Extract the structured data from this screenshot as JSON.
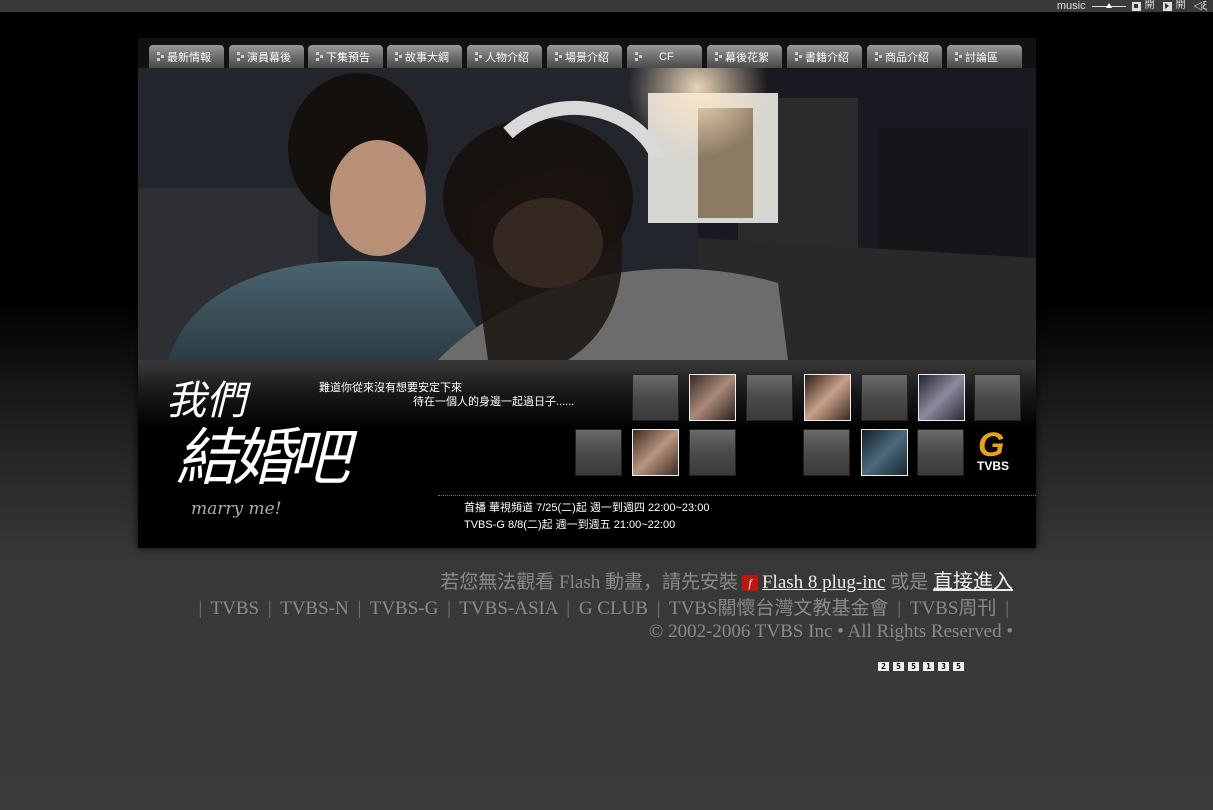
{
  "music": {
    "label": "music",
    "open1": "開",
    "open2": "開"
  },
  "nav": {
    "tabs": [
      "最新情報",
      "演員幕後",
      "下集預告",
      "故事大綱",
      "人物介紹",
      "場景介紹",
      "CF",
      "幕後花絮",
      "書籍介紹",
      "商品介紹",
      "討論區"
    ]
  },
  "logo": {
    "line1": "我們",
    "line2": "結婚吧",
    "script": "marry me!"
  },
  "tagline": {
    "line1": "難道你從來沒有想要安定下來",
    "line2": "待在一個人的身邊一起過日子......"
  },
  "airtimes": {
    "line1": "首播 華視頻道 7/25(二)起 週一到週四 22:00~23:00",
    "line2": "TVBS-G 8/8(二)起 週一到週五 21:00~22:00"
  },
  "brand": {
    "g": "G",
    "name": "TVBS"
  },
  "footer": {
    "flash_prefix": "若您無法觀看 Flash 動畫，請先安裝",
    "flash_link": "Flash 8 plug-inc",
    "or_text": "或是",
    "enter_link": "直接進入",
    "links": [
      "TVBS",
      "TVBS-N",
      "TVBS-G",
      "TVBS-ASIA",
      "G CLUB",
      "TVBS關懷台灣文教基金會",
      "TVBS周刊"
    ],
    "copyright": "© 2002-2006 TVBS Inc •  All Rights Reserved •"
  },
  "counter": [
    "2",
    "5",
    "5",
    "1",
    "3",
    "5"
  ],
  "colors": {
    "accent_red": "#c0160d",
    "tvbs_orange": "#e8a21a"
  }
}
